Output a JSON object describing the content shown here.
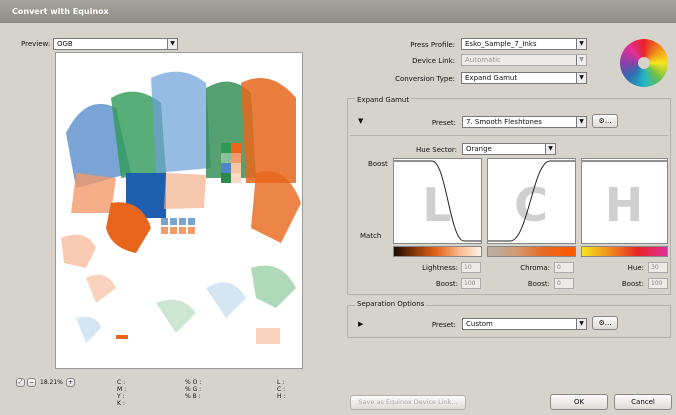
{
  "window": {
    "title": "Convert with Equinox"
  },
  "preview": {
    "label": "Preview:",
    "value": "OGB"
  },
  "press_profile": {
    "label": "Press Profile:",
    "value": "Esko_Sample_7_Inks"
  },
  "device_link": {
    "label": "Device Link:",
    "value": "Automatic"
  },
  "conversion_type": {
    "label": "Conversion Type:",
    "value": "Expand Gamut"
  },
  "expand_gamut": {
    "title": "Expand Gamut",
    "preset_label": "Preset:",
    "preset_value": "7. Smooth Fleshtones",
    "options_button": "⚙...",
    "hue_sector_label": "Hue Sector:",
    "hue_sector_value": "Orange",
    "boost_label": "Boost",
    "match_label": "Match",
    "graphs": [
      {
        "letter": "L",
        "field1_label": "Lightness:",
        "field1_value": "10",
        "field2_label": "Boost:",
        "field2_value": "100"
      },
      {
        "letter": "C",
        "field1_label": "Chroma:",
        "field1_value": "0",
        "field2_label": "Boost:",
        "field2_value": "0"
      },
      {
        "letter": "H",
        "field1_label": "Hue:",
        "field1_value": "30",
        "field2_label": "Boost:",
        "field2_value": "100"
      }
    ]
  },
  "separation_options": {
    "title": "Separation Options",
    "preset_label": "Preset:",
    "preset_value": "Custom",
    "options_button": "⚙..."
  },
  "zoom": {
    "value": "18.21%"
  },
  "readouts": {
    "col1": [
      "C :",
      "M :",
      "Y :",
      "K :"
    ],
    "col2": [
      "% O :",
      "% G :",
      "% B :"
    ],
    "col3": [
      "L :",
      "C :",
      "H :"
    ]
  },
  "buttons": {
    "save_link": "Save as Equinox Device Link...",
    "ok": "OK",
    "cancel": "Cancel"
  },
  "colors": {
    "accent_orange": "#e8661c",
    "accent_green": "#3a9a5c",
    "accent_blue": "#2f6fb3",
    "dialog_bg": "#d6d3cc"
  }
}
